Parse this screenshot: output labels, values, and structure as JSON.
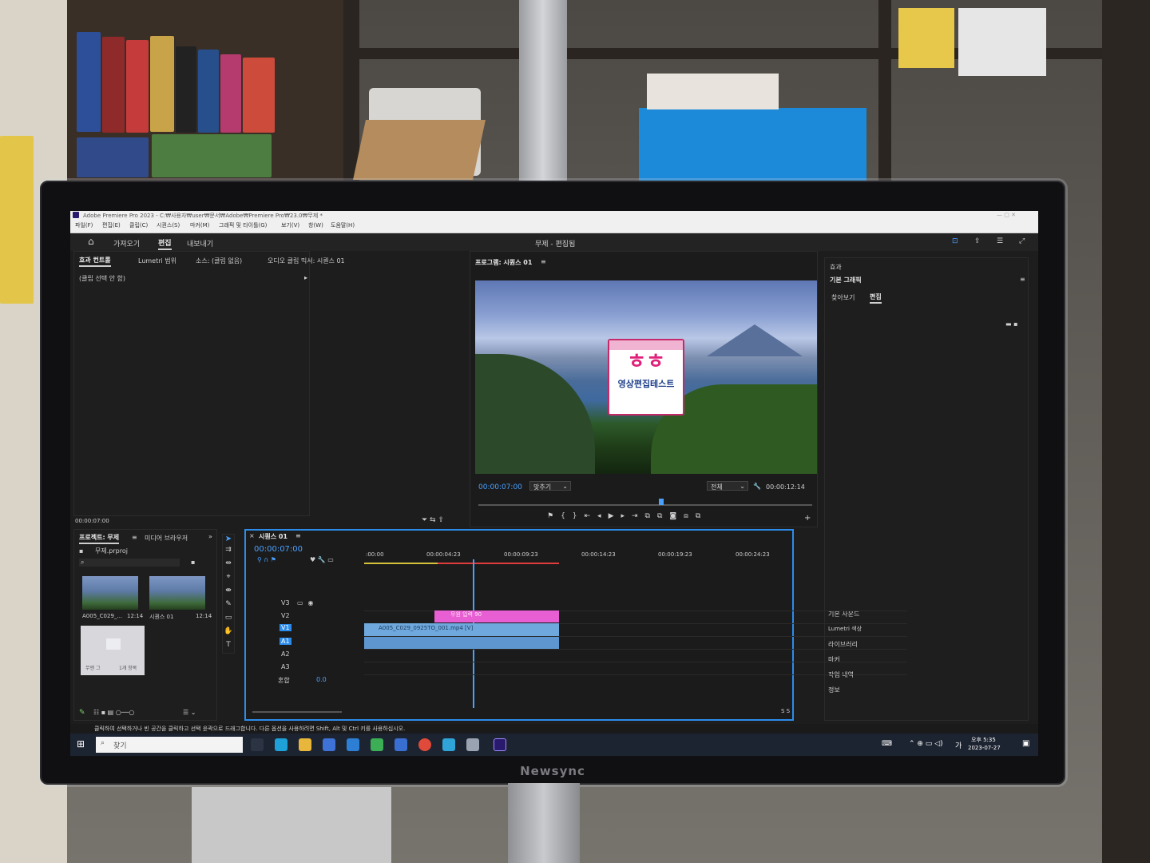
{
  "window": {
    "title": "Adobe Premiere Pro 2023 - C:₩사용자₩user₩문서₩Adobe₩Premiere Pro₩23.0₩무제 *"
  },
  "menu": [
    "파일(F)",
    "편집(E)",
    "클립(C)",
    "시퀀스(S)",
    "마커(M)",
    "그래픽 및 타이틀(G)",
    "보기(V)",
    "창(W)",
    "도움말(H)"
  ],
  "workspace": {
    "import": "가져오기",
    "edit": "편집",
    "export": "내보내기",
    "project_title": "무제 - 편집됨"
  },
  "source_panel": {
    "tabs": [
      "효과 컨트롤",
      "Lumetri 범위",
      "소스: (클립 없음)",
      "오디오 클립 믹서: 시퀀스 01"
    ],
    "no_clip": "(클립 선택 안 함)",
    "timecode": "00:00:07:00"
  },
  "program": {
    "title": "프로그램: 시퀀스 01",
    "timecode": "00:00:07:00",
    "fit": "맞추기",
    "quality": "전체",
    "duration": "00:00:12:14",
    "overlay_line1": "ㅎㅎ",
    "overlay_line2": "영상편집테스트"
  },
  "right_panel": {
    "effects": "효과",
    "essential_graphics": "기본 그래픽",
    "tab_browse": "찾아보기",
    "tab_edit": "편집",
    "items": [
      "기본 사운드",
      "Lumetri 색상",
      "라이브러리",
      "마커",
      "작업 내역",
      "정보"
    ]
  },
  "project_panel": {
    "tab_project": "프로젝트: 무제",
    "tab_media": "미디어 브라우저",
    "file": "무제.prproj",
    "items": [
      {
        "name": "A005_C029_...",
        "dur": "12:14"
      },
      {
        "name": "시퀀스 01",
        "dur": "12:14"
      }
    ],
    "bin_name": "무엔 그",
    "bin_count": "1개 항목"
  },
  "timeline": {
    "tab": "시퀀스 01",
    "timecode": "00:00:07:00",
    "ruler": [
      ":00:00",
      "00:00:04:23",
      "00:00:09:23",
      "00:00:14:23",
      "00:00:19:23",
      "00:00:24:23"
    ],
    "tracks_video": [
      "V3",
      "V2",
      "V1"
    ],
    "tracks_audio": [
      "A1",
      "A2",
      "A3"
    ],
    "mix_label": "혼합",
    "mix_value": "0.0",
    "clip_title": "무원 입력 90",
    "clip_video": "A005_C029_0925TO_001.mp4 [V]",
    "meter": "S S"
  },
  "status": {
    "hint": "클릭하여 선택하거나 빈 공간을 클릭하고 선택 윤곽으로 드래그합니다. 다른 옵션을 사용하려면 Shift, Alt 및 Ctrl 키를 사용하십시오."
  },
  "taskbar": {
    "search": "찾기",
    "time": "오후 5:35",
    "date": "2023-07-27",
    "lang": "가"
  },
  "monitor": {
    "brand": "Newsync"
  },
  "colors": {
    "accent": "#2d8ceb",
    "clip_pink": "#e85fd3",
    "clip_blue": "#6fa8dc",
    "playhead": "#4aa0ff"
  }
}
